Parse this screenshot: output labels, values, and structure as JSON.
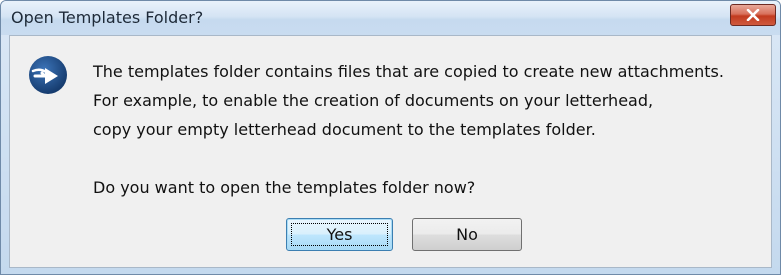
{
  "window": {
    "title": "Open Templates Folder?",
    "close_icon": "close-icon"
  },
  "dialog": {
    "icon": "arrow-right-circle-icon",
    "message_lines": [
      "The templates folder contains files that are copied to create new attachments.",
      "For example, to enable the creation of documents on your letterhead,",
      "copy your empty letterhead document to the templates folder."
    ],
    "question": "Do you want to open the templates folder now?"
  },
  "buttons": {
    "yes_label": "Yes",
    "no_label": "No"
  },
  "colors": {
    "title_bar": "#d5e4f4",
    "close_button": "#c23a1f",
    "icon_fill": "#1f4f8f",
    "content_bg": "#f0f0f0",
    "default_button_border": "#3c7fb1"
  }
}
